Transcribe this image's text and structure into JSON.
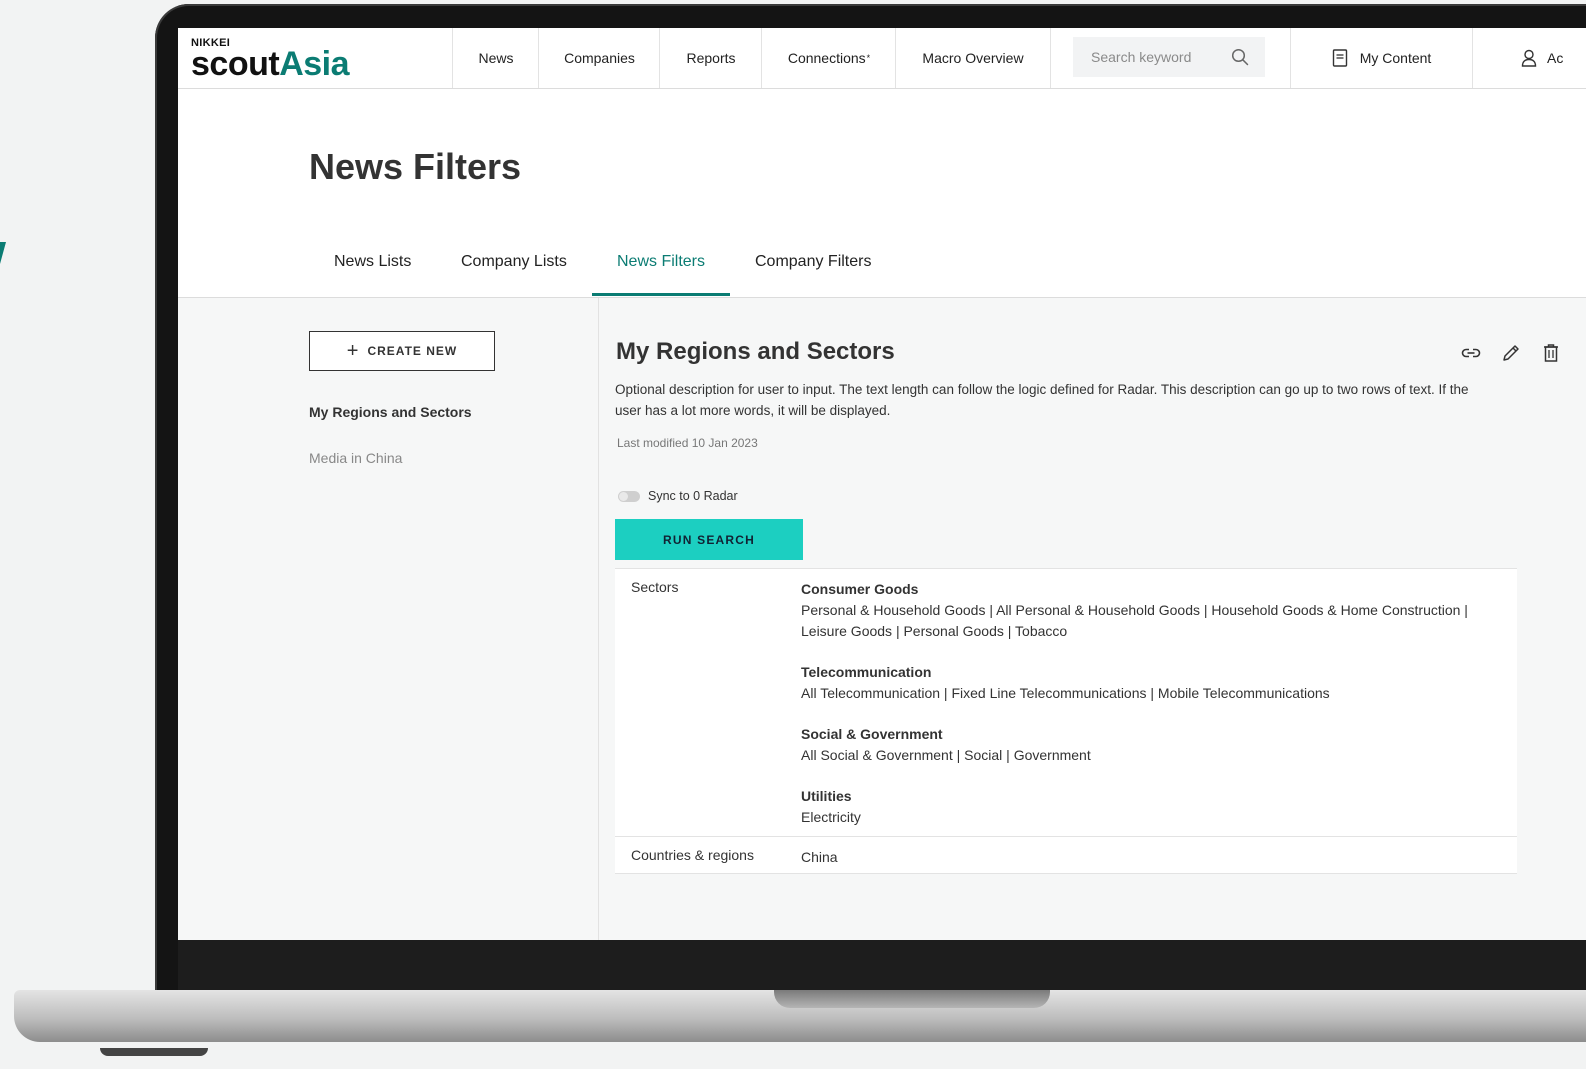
{
  "colors": {
    "brand": "#0b7c73",
    "accent_button": "#1ccfc1",
    "background": "#f6f7f7"
  },
  "logo": {
    "top": "NIKKEI",
    "scout": "scout",
    "asia": "Asia"
  },
  "nav": {
    "items": [
      "News",
      "Companies",
      "Reports",
      "Connections",
      "Macro Overview"
    ],
    "connections_mark": "*",
    "search_placeholder": "Search keyword",
    "my_content": "My Content",
    "account": "Ac"
  },
  "page": {
    "title": "News Filters",
    "tabs": [
      "News Lists",
      "Company Lists",
      "News Filters",
      "Company Filters"
    ],
    "active_tab": "News Filters"
  },
  "sidebar": {
    "create_label": "CREATE NEW",
    "items": [
      "My Regions and Sectors",
      "Media in China"
    ]
  },
  "filter": {
    "title": "My Regions and Sectors",
    "description": "Optional description for user to input. The text length can follow the logic defined for Radar. This description can go up to two rows of text. If the user has a lot more words, it will be displayed.",
    "last_modified": "Last modified 10 Jan 2023",
    "sync_label": "Sync to 0 Radar",
    "sync_on": false,
    "run_label": "RUN SEARCH",
    "action_icons": [
      "link-icon",
      "pencil-icon",
      "trash-icon"
    ]
  },
  "criteria": {
    "sectors_label": "Sectors",
    "sectors": [
      {
        "name": "Consumer Goods",
        "items": "Personal & Household Goods | All Personal & Household Goods | Household Goods & Home Construction | Leisure Goods | Personal Goods | Tobacco"
      },
      {
        "name": "Telecommunication",
        "items": "All Telecommunication | Fixed Line Telecommunications | Mobile Telecommunications"
      },
      {
        "name": "Social & Government",
        "items": "All Social & Government | Social | Government"
      },
      {
        "name": "Utilities",
        "items": "Electricity"
      }
    ],
    "regions_label": "Countries & regions",
    "regions_value": "China"
  }
}
